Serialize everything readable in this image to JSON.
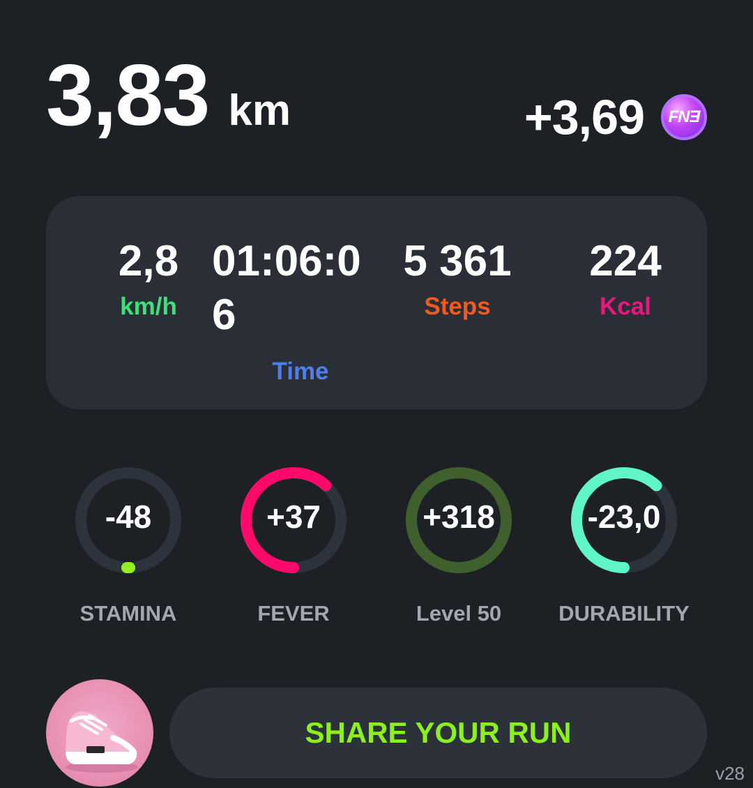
{
  "distance": {
    "value": "3,83",
    "unit": "km"
  },
  "reward": {
    "value": "+3,69",
    "token_icon": "fne-token-icon",
    "token_text": "FNƎ"
  },
  "stats": {
    "speed": {
      "value": "2,8",
      "label": "km/h"
    },
    "time": {
      "value": "01:06:06",
      "label": "Time"
    },
    "steps": {
      "value": "5 361",
      "label": "Steps"
    },
    "kcal": {
      "value": "224",
      "label": "Kcal"
    }
  },
  "gauges": [
    {
      "value": "-48",
      "label": "STAMINA",
      "color": "#93f01e",
      "fill": 0.0
    },
    {
      "value": "+37",
      "label": "FEVER",
      "color": "#ff0a6b",
      "fill": 0.62
    },
    {
      "value": "+318",
      "label": "Level 50",
      "color": "#3f5f2c",
      "fill": 1.0
    },
    {
      "value": "-23,0",
      "label": "DURABILITY",
      "color": "#5ff5c8",
      "fill": 0.62
    }
  ],
  "share": {
    "label": "SHARE YOUR RUN"
  },
  "version": "v28",
  "colors": {
    "background": "#1d2025",
    "card": "#2a2f37",
    "speed": "#3ee07a",
    "time": "#4f7fef",
    "steps": "#f35a1f",
    "kcal": "#e8187c",
    "share_text": "#8cf01e"
  }
}
